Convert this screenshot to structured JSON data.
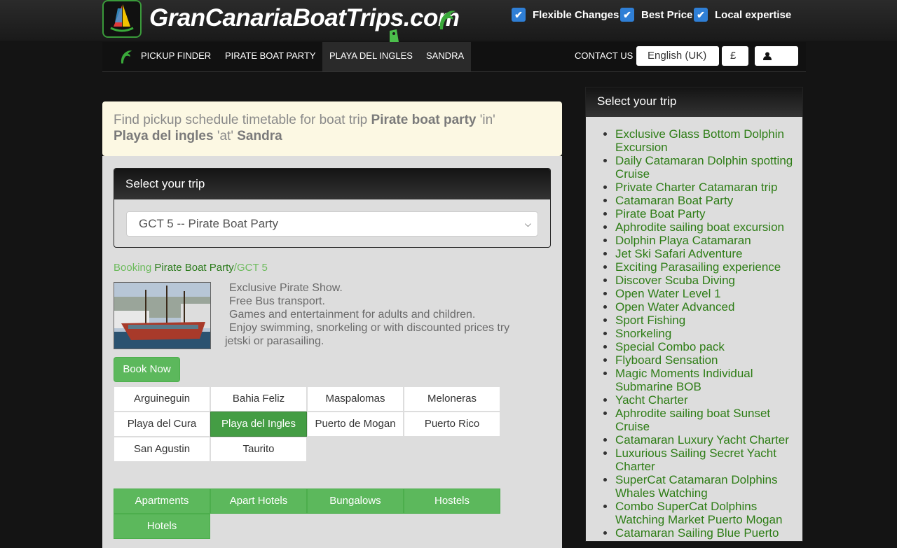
{
  "header": {
    "logo_text": "GranCanariaBoatTrips.com",
    "features": [
      "Flexible Changes",
      "Best Price",
      "Local expertise"
    ]
  },
  "nav": {
    "items": [
      "PICKUP FINDER",
      "PIRATE BOAT PARTY",
      "PLAYA DEL INGLES",
      "SANDRA"
    ],
    "contact": "CONTACT US",
    "language": "English (UK)",
    "currency": "£"
  },
  "alert": {
    "prefix": "Find pickup schedule timetable for boat trip ",
    "trip": "Pirate boat party",
    "in_word": " 'in' ",
    "area": "Playa del ingles",
    "at_word": " 'at' ",
    "hotel": "Sandra"
  },
  "trip_panel": {
    "heading": "Select your trip",
    "selected": "GCT 5 -- Pirate Boat Party"
  },
  "breadcrumb": {
    "booking": "Booking",
    "trip": "Pirate Boat Party",
    "code": "/GCT 5"
  },
  "description": [
    "Exclusive Pirate Show.",
    "Free Bus transport.",
    "Games and entertainment for adults and children.",
    "Enjoy swimming, snorkeling or with discounted prices try"
  ],
  "description_tail": "jetski or parasailing.",
  "book_now": "Book Now",
  "areas": [
    "Arguineguin",
    "Bahia Feliz",
    "Maspalomas",
    "Meloneras",
    "Playa del Cura",
    "Playa del Ingles",
    "Puerto de Mogan",
    "Puerto Rico",
    "San Agustin",
    "Taurito"
  ],
  "active_area": "Playa del Ingles",
  "accommodation": [
    "Apartments",
    "Apart Hotels",
    "Bungalows",
    "Hostels",
    "Hotels"
  ],
  "sidebar": {
    "heading": "Select your trip",
    "trips": [
      "Exclusive Glass Bottom Dolphin Excursion",
      "Daily Catamaran Dolphin spotting Cruise",
      "Private Charter Catamaran trip",
      "Catamaran Boat Party",
      "Pirate Boat Party",
      "Aphrodite sailing boat excursion",
      "Dolphin Playa Catamaran",
      "Jet Ski Safari Adventure",
      "Exciting Parasailing experience",
      "Discover Scuba Diving",
      "Open Water Level 1",
      "Open Water Advanced",
      "Sport Fishing",
      "Snorkeling",
      "Special Combo pack",
      "Flyboard Sensation",
      "Magic Moments Individual Submarine BOB",
      "Yacht Charter",
      "Aphrodite sailing boat Sunset Cruise",
      "Catamaran Luxury Yacht Charter",
      "Luxurious Sailing Secret Yacht Charter",
      "SuperCat Catamaran Dolphins Whales Watching",
      "Combo SuperCat Dolphins Watching Market Puerto Mogan",
      "Catamaran Sailing Blue Puerto"
    ]
  },
  "colors": {
    "accent_green": "#5cb85c",
    "active_green": "#449d44",
    "link_green": "#2e7d16",
    "checkbox_blue": "#2f7fd6"
  },
  "icons": [
    "sailboat-logo-icon",
    "dolphin-icon",
    "tag-icon",
    "check-icon",
    "user-icon",
    "caret-down-icon"
  ]
}
